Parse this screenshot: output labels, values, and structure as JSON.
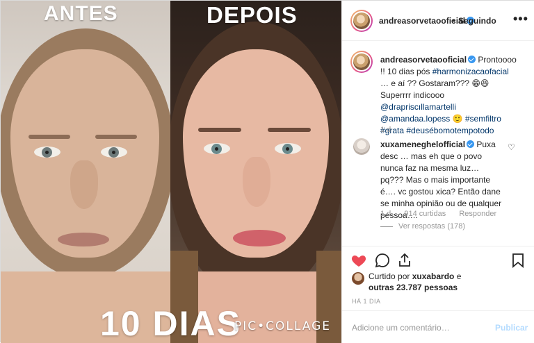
{
  "image": {
    "label_before": "ANTES",
    "label_after": "DEPOIS",
    "overlay_text": "10 DIAS",
    "watermark": "PIC•COLLAGE"
  },
  "header": {
    "username": "andreasorvetaooficial",
    "separator": "•",
    "follow_status": "Seguindo",
    "more_icon": "•••"
  },
  "caption": {
    "username": "andreasorvetaooficial",
    "text_1": "Prontoooo !! 10 dias pós ",
    "hashtag_1": "#harmonizacaofacial",
    "text_2": " … e aí ?? Gostaram??? 😁😆 Superrrr indicooo ",
    "mention_1": "@drapriscıllamartelli",
    "mention_2": "@amandaa.lopess",
    "text_3": " 🙂 ",
    "hashtag_2": "#semfiltro",
    "hashtag_3": "#grata",
    "hashtag_4": "#deusébomotempotodo",
    "age": "1 d"
  },
  "comment": {
    "username": "xuxameneghelofficial",
    "text": "Puxa desc … mas eh que o povo nunca faz na mesma luz… pq??? Mas o mais importante é…. vc gostou xica? Então dane se minha opinião ou de qualquer pessoa….",
    "age": "1 d",
    "likes": "914 curtidas",
    "reply": "Responder",
    "view_replies": "Ver respostas (178)"
  },
  "actions": {
    "like_icon": "heart-filled",
    "comment_icon": "speech-bubble",
    "share_icon": "share-arrow",
    "save_icon": "bookmark",
    "like_color": "#ed4956"
  },
  "likes": {
    "prefix": "Curtido por ",
    "by_user": "xuxabardo",
    "connector": " e",
    "others": "outras 23.787 pessoas"
  },
  "timestamp": "HÁ 1 DIA",
  "add_comment": {
    "placeholder": "Adicione um comentário…",
    "publish": "Publicar"
  }
}
